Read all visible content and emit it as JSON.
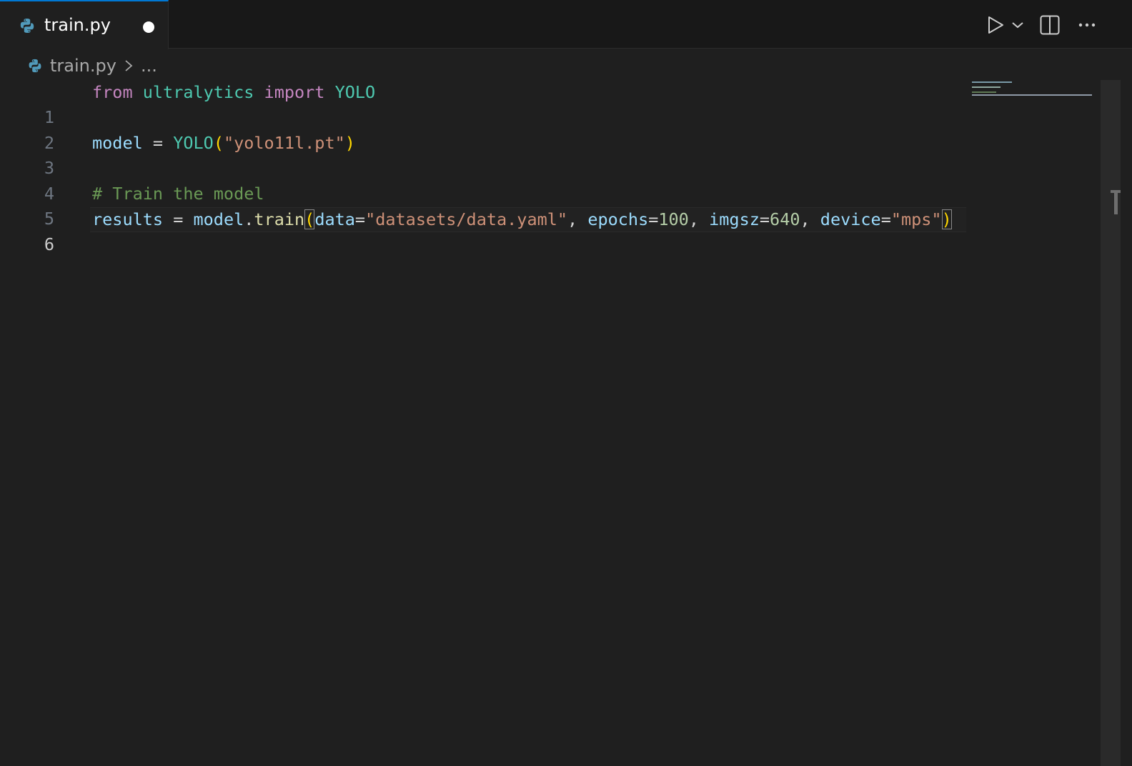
{
  "tab": {
    "label": "train.py",
    "icon": "python-icon",
    "dirty": true
  },
  "toolbar": {
    "run_icon": "play-icon",
    "run_dropdown_icon": "chevron-down-icon",
    "split_icon": "split-editor-icon",
    "more_icon": "more-actions-icon"
  },
  "breadcrumb": {
    "file": "train.py",
    "separator_icon": "chevron-right-icon",
    "symbol": "..."
  },
  "editor": {
    "current_line": 6,
    "lines": [
      {
        "number": "1",
        "tokens": [
          "from",
          " ",
          "ultralytics",
          " ",
          "import",
          " ",
          "YOLO"
        ]
      },
      {
        "number": "2",
        "tokens": []
      },
      {
        "number": "3",
        "tokens": [
          "model",
          " ",
          "=",
          " ",
          "YOLO",
          "(",
          "\"yolo11l.pt\"",
          ")"
        ]
      },
      {
        "number": "4",
        "tokens": []
      },
      {
        "number": "5",
        "tokens": [
          "# Train the model"
        ]
      },
      {
        "number": "6",
        "tokens": [
          "results",
          " ",
          "=",
          " ",
          "model",
          ".",
          "train",
          "(",
          "data",
          "=",
          "\"datasets/data.yaml\"",
          ", ",
          "epochs",
          "=",
          "100",
          ", ",
          "imgsz",
          "=",
          "640",
          ", ",
          "device",
          "=",
          "\"mps\"",
          ")"
        ]
      }
    ]
  },
  "colors": {
    "keyword": "#c586c0",
    "class": "#4ec9b0",
    "variable": "#9cdcfe",
    "string": "#ce9178",
    "number": "#b5cea8",
    "function": "#dcdcaa",
    "comment": "#6a9955",
    "bracket": "#ffd700",
    "accent": "#0078d4"
  }
}
